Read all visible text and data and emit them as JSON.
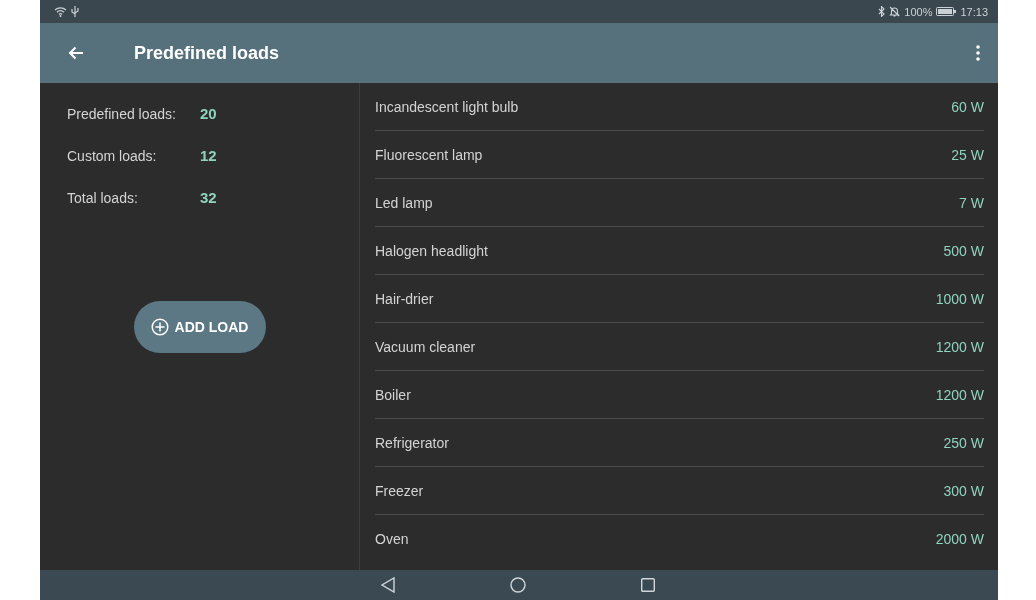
{
  "status_bar": {
    "battery": "100%",
    "time": "17:13"
  },
  "app_bar": {
    "title": "Predefined loads"
  },
  "summary": [
    {
      "label": "Predefined loads:",
      "value": "20"
    },
    {
      "label": "Custom loads:",
      "value": "12"
    },
    {
      "label": "Total loads:",
      "value": "32"
    }
  ],
  "add_button": "ADD LOAD",
  "loads": [
    {
      "name": "Incandescent light bulb",
      "power": "60 W"
    },
    {
      "name": "Fluorescent lamp",
      "power": "25 W"
    },
    {
      "name": "Led lamp",
      "power": "7 W"
    },
    {
      "name": "Halogen headlight",
      "power": "500 W"
    },
    {
      "name": "Hair-drier",
      "power": "1000 W"
    },
    {
      "name": "Vacuum cleaner",
      "power": "1200 W"
    },
    {
      "name": "Boiler",
      "power": "1200 W"
    },
    {
      "name": "Refrigerator",
      "power": "250 W"
    },
    {
      "name": "Freezer",
      "power": "300 W"
    },
    {
      "name": "Oven",
      "power": "2000 W"
    }
  ]
}
